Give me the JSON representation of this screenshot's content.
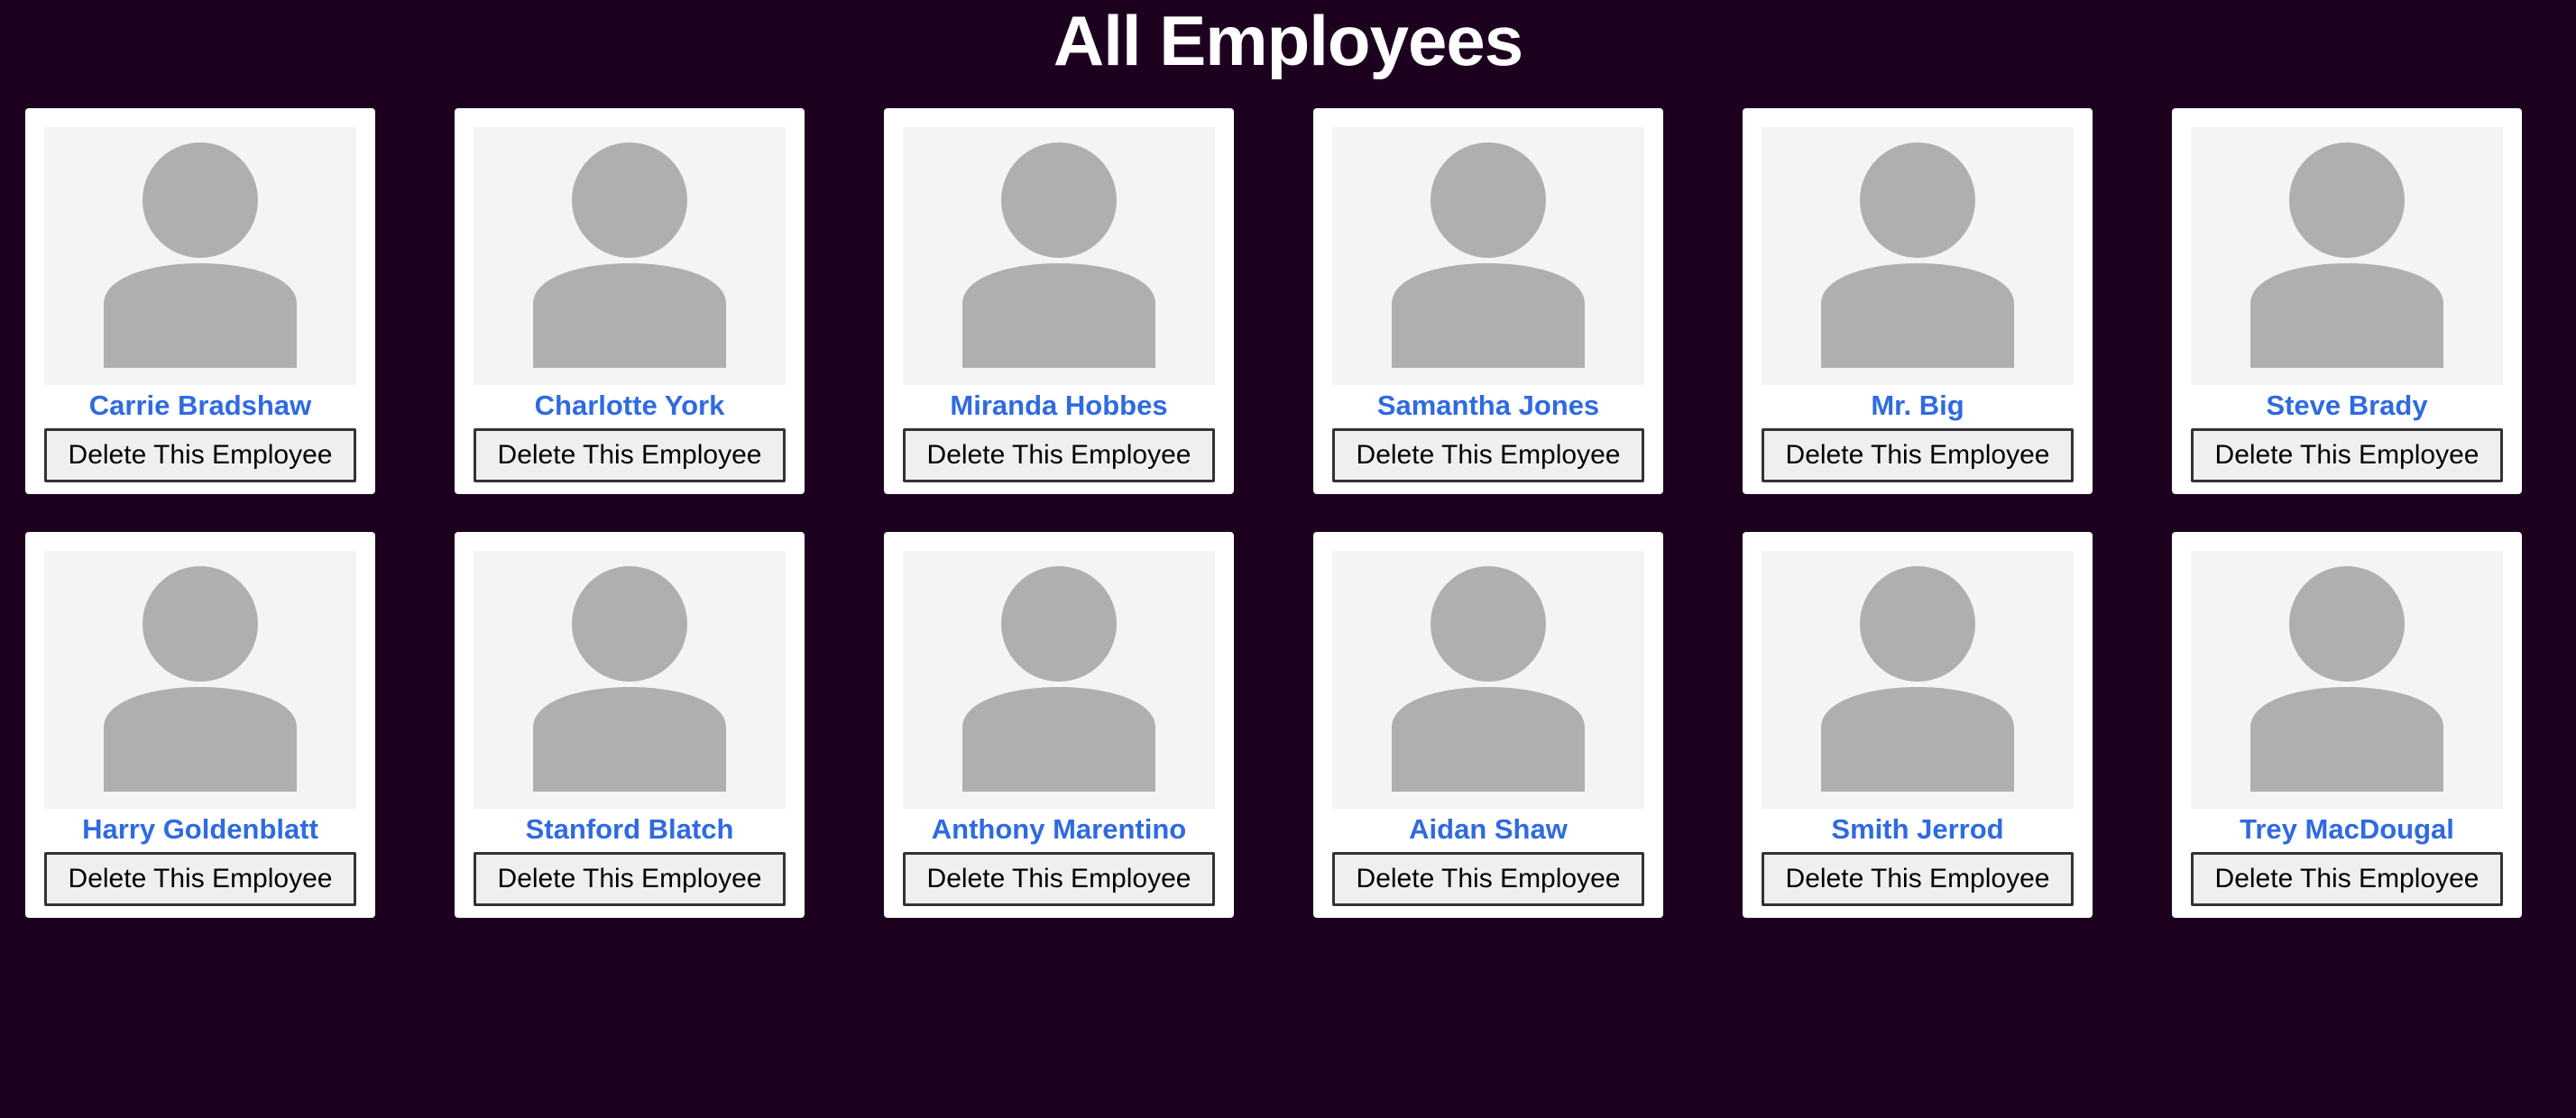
{
  "page": {
    "title": "All Employees",
    "background_color": "#1d0220",
    "name_color": "#2f6ae0"
  },
  "employees": [
    {
      "name": "Carrie Bradshaw",
      "delete_label": "Delete This Employee",
      "avatar_icon": "person-placeholder-icon"
    },
    {
      "name": "Charlotte York",
      "delete_label": "Delete This Employee",
      "avatar_icon": "person-placeholder-icon"
    },
    {
      "name": "Miranda Hobbes",
      "delete_label": "Delete This Employee",
      "avatar_icon": "person-placeholder-icon"
    },
    {
      "name": "Samantha Jones",
      "delete_label": "Delete This Employee",
      "avatar_icon": "person-placeholder-icon"
    },
    {
      "name": "Mr. Big",
      "delete_label": "Delete This Employee",
      "avatar_icon": "person-placeholder-icon"
    },
    {
      "name": "Steve Brady",
      "delete_label": "Delete This Employee",
      "avatar_icon": "person-placeholder-icon"
    },
    {
      "name": "Harry Goldenblatt",
      "delete_label": "Delete This Employee",
      "avatar_icon": "person-placeholder-icon"
    },
    {
      "name": "Stanford Blatch",
      "delete_label": "Delete This Employee",
      "avatar_icon": "person-placeholder-icon"
    },
    {
      "name": "Anthony Marentino",
      "delete_label": "Delete This Employee",
      "avatar_icon": "person-placeholder-icon"
    },
    {
      "name": "Aidan Shaw",
      "delete_label": "Delete This Employee",
      "avatar_icon": "person-placeholder-icon"
    },
    {
      "name": "Smith Jerrod",
      "delete_label": "Delete This Employee",
      "avatar_icon": "person-placeholder-icon"
    },
    {
      "name": "Trey MacDougal",
      "delete_label": "Delete This Employee",
      "avatar_icon": "person-placeholder-icon"
    }
  ]
}
